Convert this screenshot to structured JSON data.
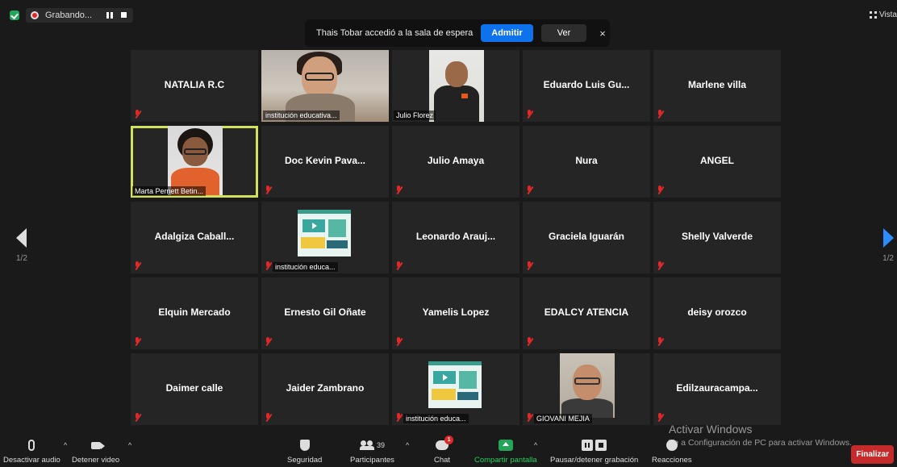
{
  "recording": {
    "status": "Grabando..."
  },
  "notification": {
    "message": "Thais Tobar accedió a la sala de espera",
    "admit_label": "Admitir",
    "view_label": "Ver",
    "close_glyph": "×"
  },
  "view_label": "Vista",
  "pager": {
    "left_page": "1/2",
    "right_page": "1/2"
  },
  "tiles": [
    {
      "name": "NATALIA R.C",
      "muted": true
    },
    {
      "video": "woman",
      "label": "institución educativa...",
      "muted": false
    },
    {
      "video": "julio",
      "label": "Julio Florez",
      "muted": false
    },
    {
      "name": "Eduardo Luis Gu...",
      "muted": true
    },
    {
      "name": "Marlene villa",
      "muted": true
    },
    {
      "video": "marta",
      "label": "Marta  Pernett Betin...",
      "muted": false,
      "active": true
    },
    {
      "name": "Doc Kevin Pava...",
      "muted": true
    },
    {
      "name": "Julio Amaya",
      "muted": true
    },
    {
      "name": "Nura",
      "muted": true
    },
    {
      "name": "ANGEL",
      "muted": true
    },
    {
      "name": "Adalgiza  Caball...",
      "muted": true
    },
    {
      "video": "slide",
      "label": "institución educa...",
      "muted": true
    },
    {
      "name": "Leonardo  Arauj...",
      "muted": true
    },
    {
      "name": "Graciela Iguarán",
      "muted": true
    },
    {
      "name": "Shelly Valverde",
      "muted": true
    },
    {
      "name": "Elquin Mercado",
      "muted": true
    },
    {
      "name": "Ernesto Gil Oñate",
      "muted": true
    },
    {
      "name": "Yamelis Lopez",
      "muted": true
    },
    {
      "name": "EDALCY ATENCIA",
      "muted": true
    },
    {
      "name": "deisy orozco",
      "muted": true
    },
    {
      "name": "Daimer calle",
      "muted": true
    },
    {
      "name": "Jaider Zambrano",
      "muted": true
    },
    {
      "video": "slide",
      "label": "institución educa...",
      "muted": true
    },
    {
      "video": "giovani",
      "label": "GIOVANI MEJIA",
      "muted": true
    },
    {
      "name": "Edilzauracampa...",
      "muted": true
    }
  ],
  "watermark": {
    "title": "Activar Windows",
    "subtitle": "Ve a Configuración de PC para activar Windows."
  },
  "toolbar": {
    "mute_label": "Desactivar audio",
    "video_label": "Detener video",
    "security_label": "Seguridad",
    "participants_label": "Participantes",
    "participants_count": "39",
    "chat_label": "Chat",
    "chat_badge": "1",
    "share_label": "Compartir pantalla",
    "recording_label": "Pausar/detener grabación",
    "reactions_label": "Reacciones",
    "end_label": "Finalizar",
    "caret": "^"
  },
  "colors": {
    "accent": "#0e72ed",
    "share": "#23a55a",
    "end": "#c52b2b",
    "active_speaker": "#d2e05a",
    "mute": "#e02828"
  }
}
